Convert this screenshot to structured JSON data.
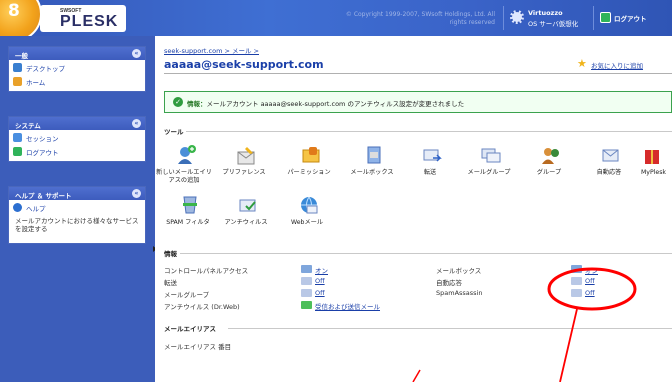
{
  "brand": {
    "badge": "8",
    "swsoft": "SWSOFT",
    "plesk": "PLESK"
  },
  "header": {
    "copyright": "© Copyright 1999-2007, SWsoft Holdings, Ltd. All rights reserved",
    "virtuozzo_title": "Virtuozzo",
    "virtuozzo_sub": "OS サーバ仮想化",
    "logout": "ログアウト"
  },
  "sidebar": {
    "general": {
      "title": "一般",
      "items": [
        {
          "label": "デスクトップ",
          "icon": "desktop-icon"
        },
        {
          "label": "ホーム",
          "icon": "home-icon"
        }
      ]
    },
    "system": {
      "title": "システム",
      "items": [
        {
          "label": "セッション",
          "icon": "session-icon"
        },
        {
          "label": "ログアウト",
          "icon": "logout-icon"
        }
      ]
    },
    "help": {
      "title": "ヘルプ ＆ サポート",
      "items": [
        {
          "label": "ヘルプ",
          "icon": "help-icon"
        }
      ],
      "note": "メールアカウントにおける様々なサービスを設定する"
    }
  },
  "main": {
    "breadcrumb": "seek-support.com > メール >",
    "title": "aaaaa@seek-support.com",
    "favorites": "お気に入りに追加",
    "info_label": "情報：",
    "info_message": "メールアカウント aaaaa@seek-support.com のアンチウィルス設定が変更されました",
    "tools_title": "ツール",
    "tools": [
      {
        "label": "新しいメールエイリアスの追加",
        "icon": "add-alias-icon"
      },
      {
        "label": "プリファレンス",
        "icon": "preferences-icon"
      },
      {
        "label": "パーミッション",
        "icon": "permissions-icon"
      },
      {
        "label": "メールボックス",
        "icon": "mailbox-icon"
      },
      {
        "label": "転送",
        "icon": "forwarding-icon"
      },
      {
        "label": "メールグループ",
        "icon": "mail-group-icon"
      },
      {
        "label": "グループ",
        "icon": "groups-icon"
      },
      {
        "label": "自動応答",
        "icon": "autoresponder-icon"
      },
      {
        "label": "MyPlesk",
        "icon": "myplesk-icon"
      },
      {
        "label": "SPAM フィルタ",
        "icon": "spam-filter-icon"
      },
      {
        "label": "アンチウィルス",
        "icon": "antivirus-icon"
      },
      {
        "label": "Webメール",
        "icon": "webmail-icon"
      }
    ],
    "info_section_title": "情報",
    "info_rows_left": [
      {
        "label": "コントロールパネルアクセス",
        "value": "オン"
      },
      {
        "label": "転送",
        "value": "Off"
      },
      {
        "label": "メールグループ",
        "value": "Off"
      },
      {
        "label": "アンチウイルス (Dr.Web)",
        "value": "受信および送信メール"
      }
    ],
    "info_rows_right": [
      {
        "label": "メールボックス",
        "value": "オン"
      },
      {
        "label": "自動応答",
        "value": "Off"
      },
      {
        "label": "SpamAssassin",
        "value": "Off"
      }
    ],
    "aliases_title": "メールエイリアス",
    "aliases_row": "メールエイリアス 番目"
  },
  "colors": {
    "header_blue": "#3457b8",
    "link": "#1a3fa8",
    "annotation": "#ff0000",
    "success": "#2f9c3f"
  }
}
